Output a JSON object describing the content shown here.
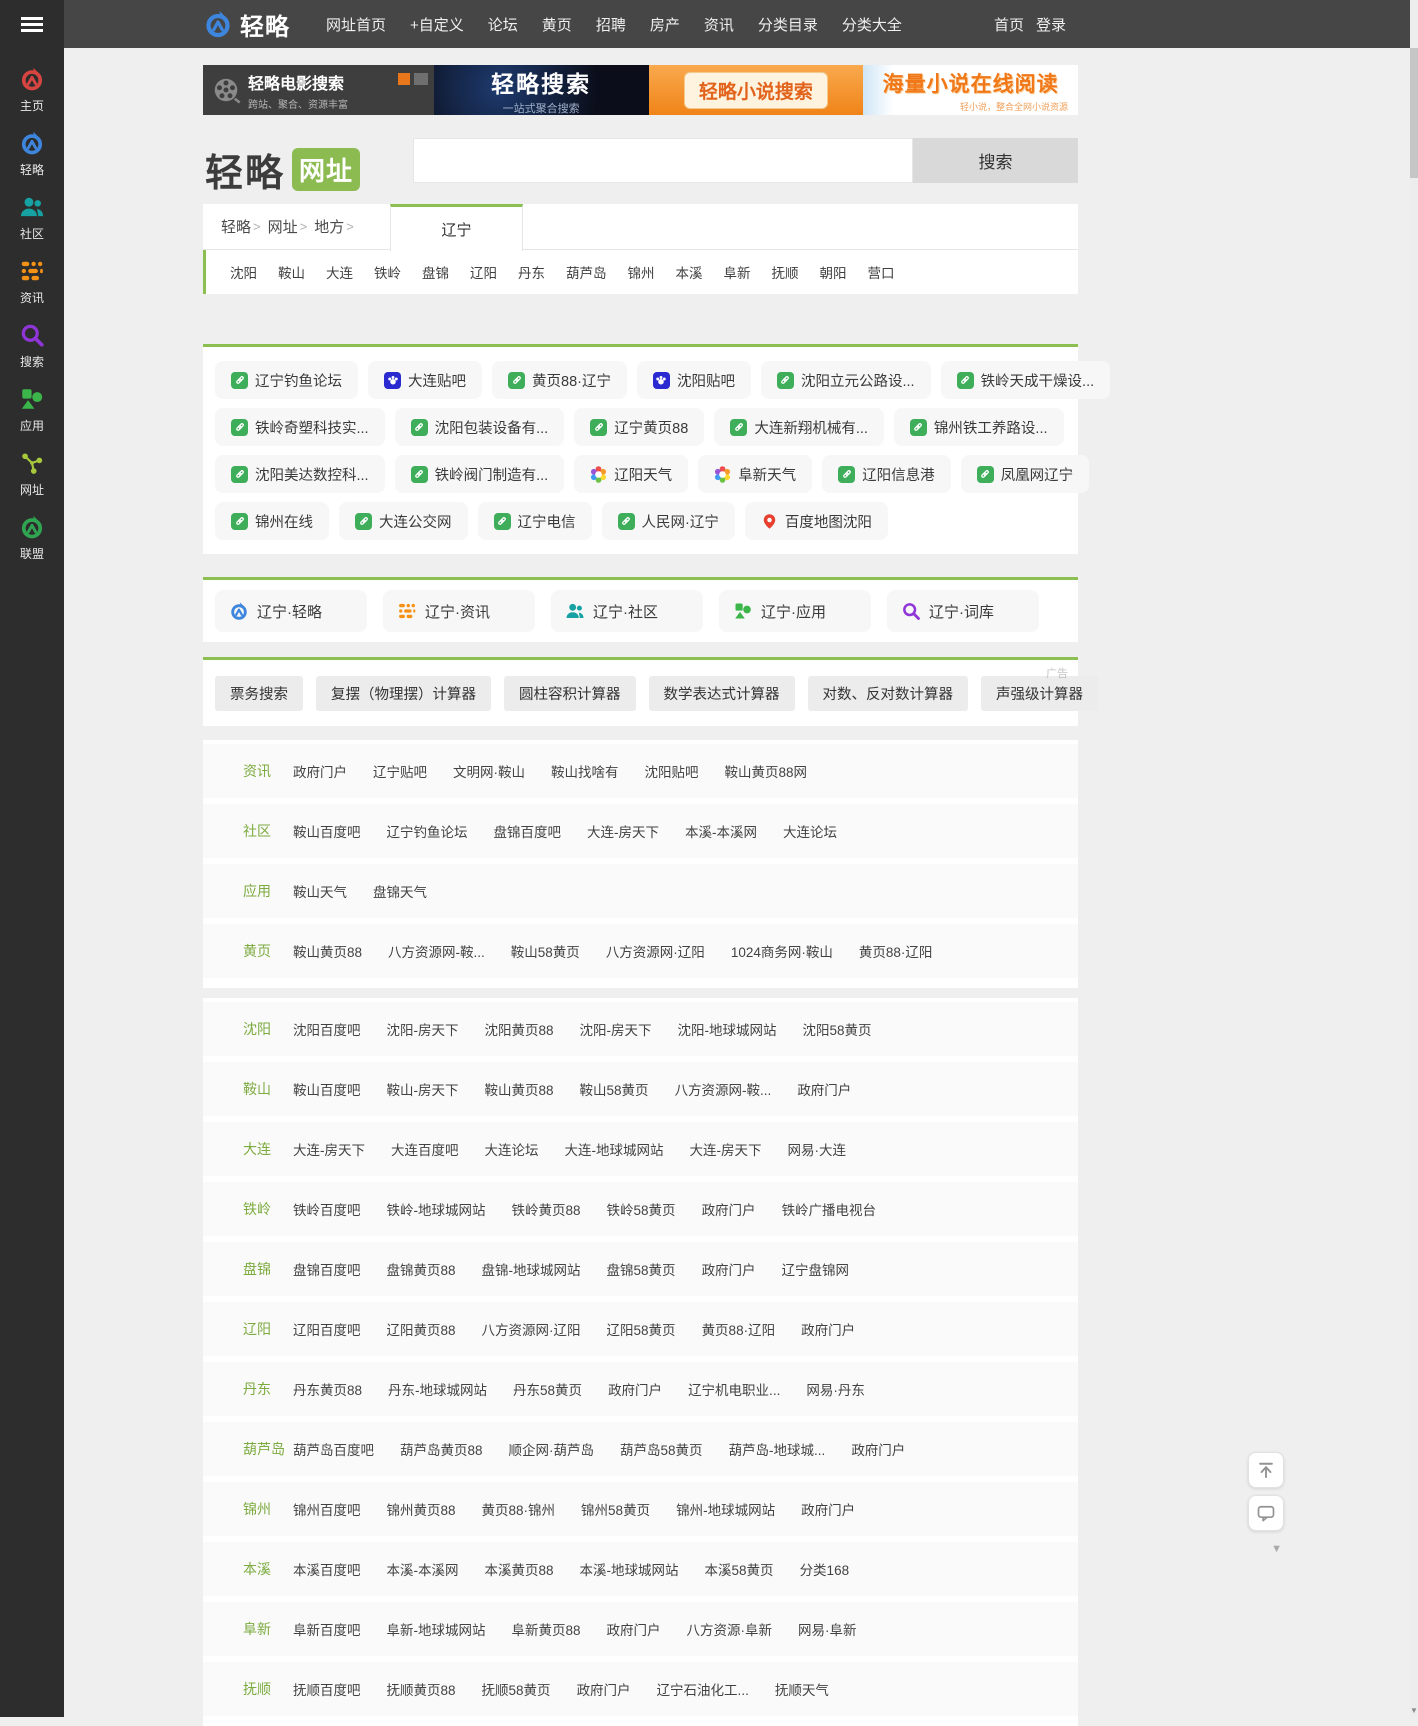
{
  "navbar": {
    "logo": "轻略",
    "menu": [
      "网址首页",
      "+自定义",
      "论坛",
      "黄页",
      "招聘",
      "房产",
      "资讯",
      "分类目录",
      "分类大全"
    ],
    "right_links": [
      "首页",
      "登录"
    ]
  },
  "sidebar": {
    "items": [
      {
        "label": "主页",
        "icon": "logo-red-icon"
      },
      {
        "label": "轻略",
        "icon": "logo-blue-icon"
      },
      {
        "label": "社区",
        "icon": "people-teal-icon"
      },
      {
        "label": "资讯",
        "icon": "grid-orange-icon"
      },
      {
        "label": "搜索",
        "icon": "magnifier-purple-icon"
      },
      {
        "label": "应用",
        "icon": "shapes-green-icon"
      },
      {
        "label": "网址",
        "icon": "share-lime-icon"
      },
      {
        "label": "联盟",
        "icon": "logo-green-icon"
      }
    ]
  },
  "banners": [
    {
      "title": "轻略电影搜索",
      "subtitle": "跨站、聚合、资源丰富"
    },
    {
      "title": "轻略搜索",
      "subtitle": "一站式聚合搜索"
    },
    {
      "title": "轻略小说搜索",
      "subtitle": ""
    },
    {
      "title": "海量小说在线阅读",
      "subtitle": "轻小说，整合全网小说资源"
    }
  ],
  "header": {
    "brand": "轻略",
    "brand_badge": "网址",
    "search_value": "",
    "search_button": "搜索"
  },
  "breadcrumb": {
    "path": [
      "轻略",
      "网址",
      "地方"
    ],
    "active_tab": "辽宁"
  },
  "cities": [
    "沈阳",
    "鞍山",
    "大连",
    "铁岭",
    "盘锦",
    "辽阳",
    "丹东",
    "葫芦岛",
    "锦州",
    "本溪",
    "阜新",
    "抚顺",
    "朝阳",
    "营口"
  ],
  "quick_links": {
    "rows": [
      [
        {
          "label": "辽宁钓鱼论坛",
          "icon": "link-icon",
          "sym": "#sym-chain"
        },
        {
          "label": "大连贴吧",
          "icon": "tieba-icon",
          "sym": "#sym-paw"
        },
        {
          "label": "黄页88·辽宁",
          "icon": "link-icon",
          "sym": "#sym-chain"
        },
        {
          "label": "沈阳贴吧",
          "icon": "tieba-icon",
          "sym": "#sym-paw"
        },
        {
          "label": "沈阳立元公路设...",
          "icon": "link-icon",
          "sym": "#sym-chain"
        },
        {
          "label": "铁岭天成干燥设...",
          "icon": "link-icon",
          "sym": "#sym-chain"
        }
      ],
      [
        {
          "label": "铁岭奇塑科技实...",
          "icon": "link-icon",
          "sym": "#sym-chain"
        },
        {
          "label": "沈阳包装设备有...",
          "icon": "link-icon",
          "sym": "#sym-chain"
        },
        {
          "label": "辽宁黄页88",
          "icon": "link-icon",
          "sym": "#sym-chain"
        },
        {
          "label": "大连新翔机械有...",
          "icon": "link-icon",
          "sym": "#sym-chain"
        },
        {
          "label": "锦州铁工养路设...",
          "icon": "link-icon",
          "sym": "#sym-chain"
        }
      ],
      [
        {
          "label": "沈阳美达数控科...",
          "icon": "link-icon",
          "sym": "#sym-chain"
        },
        {
          "label": "铁岭阀门制造有...",
          "icon": "link-icon",
          "sym": "#sym-chain"
        },
        {
          "label": "辽阳天气",
          "icon": "weather-icon",
          "sym": "#sym-weather"
        },
        {
          "label": "阜新天气",
          "icon": "weather-icon",
          "sym": "#sym-weather"
        },
        {
          "label": "辽阳信息港",
          "icon": "link-icon",
          "sym": "#sym-chain"
        },
        {
          "label": "凤凰网辽宁",
          "icon": "link-icon",
          "sym": "#sym-chain"
        }
      ],
      [
        {
          "label": "锦州在线",
          "icon": "link-icon",
          "sym": "#sym-chain"
        },
        {
          "label": "大连公交网",
          "icon": "link-icon",
          "sym": "#sym-chain"
        },
        {
          "label": "辽宁电信",
          "icon": "link-icon",
          "sym": "#sym-chain"
        },
        {
          "label": "人民网·辽宁",
          "icon": "link-icon",
          "sym": "#sym-chain"
        },
        {
          "label": "百度地图沈阳",
          "icon": "map-pin-icon",
          "sym": "#sym-pin"
        }
      ]
    ]
  },
  "shortcuts": [
    {
      "label": "辽宁·轻略",
      "icon": "logo-blue-icon"
    },
    {
      "label": "辽宁·资讯",
      "icon": "grid-orange-icon"
    },
    {
      "label": "辽宁·社区",
      "icon": "people-teal-icon"
    },
    {
      "label": "辽宁·应用",
      "icon": "shapes-green-icon"
    },
    {
      "label": "辽宁·词库",
      "icon": "magnifier-purple-icon"
    }
  ],
  "tools": {
    "items": [
      "票务搜索",
      "复摆（物理摆）计算器",
      "圆柱容积计算器",
      "数学表达式计算器",
      "对数、反对数计算器",
      "声强级计算器"
    ],
    "ad_label": "广告"
  },
  "category_table": {
    "rows": [
      {
        "label": "资讯",
        "links": [
          "政府门户",
          "辽宁贴吧",
          "文明网·鞍山",
          "鞍山找啥有",
          "沈阳贴吧",
          "鞍山黄页88网"
        ]
      },
      {
        "label": "社区",
        "links": [
          "鞍山百度吧",
          "辽宁钓鱼论坛",
          "盘锦百度吧",
          "大连-房天下",
          "本溪-本溪网",
          "大连论坛"
        ]
      },
      {
        "label": "应用",
        "links": [
          "鞍山天气",
          "盘锦天气"
        ]
      },
      {
        "label": "黄页",
        "links": [
          "鞍山黄页88",
          "八方资源网-鞍...",
          "鞍山58黄页",
          "八方资源网·辽阳",
          "1024商务网·鞍山",
          "黄页88·辽阳"
        ]
      }
    ]
  },
  "city_table": {
    "rows": [
      {
        "label": "沈阳",
        "links": [
          "沈阳百度吧",
          "沈阳-房天下",
          "沈阳黄页88",
          "沈阳-房天下",
          "沈阳-地球城网站",
          "沈阳58黄页"
        ]
      },
      {
        "label": "鞍山",
        "links": [
          "鞍山百度吧",
          "鞍山-房天下",
          "鞍山黄页88",
          "鞍山58黄页",
          "八方资源网-鞍...",
          "政府门户"
        ]
      },
      {
        "label": "大连",
        "links": [
          "大连-房天下",
          "大连百度吧",
          "大连论坛",
          "大连-地球城网站",
          "大连-房天下",
          "网易·大连"
        ]
      },
      {
        "label": "铁岭",
        "links": [
          "铁岭百度吧",
          "铁岭-地球城网站",
          "铁岭黄页88",
          "铁岭58黄页",
          "政府门户",
          "铁岭广播电视台"
        ]
      },
      {
        "label": "盘锦",
        "links": [
          "盘锦百度吧",
          "盘锦黄页88",
          "盘锦-地球城网站",
          "盘锦58黄页",
          "政府门户",
          "辽宁盘锦网"
        ]
      },
      {
        "label": "辽阳",
        "links": [
          "辽阳百度吧",
          "辽阳黄页88",
          "八方资源网·辽阳",
          "辽阳58黄页",
          "黄页88·辽阳",
          "政府门户"
        ]
      },
      {
        "label": "丹东",
        "links": [
          "丹东黄页88",
          "丹东-地球城网站",
          "丹东58黄页",
          "政府门户",
          "辽宁机电职业...",
          "网易·丹东"
        ]
      },
      {
        "label": "葫芦岛",
        "links": [
          "葫芦岛百度吧",
          "葫芦岛黄页88",
          "顺企网·葫芦岛",
          "葫芦岛58黄页",
          "葫芦岛-地球城...",
          "政府门户"
        ]
      },
      {
        "label": "锦州",
        "links": [
          "锦州百度吧",
          "锦州黄页88",
          "黄页88·锦州",
          "锦州58黄页",
          "锦州-地球城网站",
          "政府门户"
        ]
      },
      {
        "label": "本溪",
        "links": [
          "本溪百度吧",
          "本溪-本溪网",
          "本溪黄页88",
          "本溪-地球城网站",
          "本溪58黄页",
          "分类168"
        ]
      },
      {
        "label": "阜新",
        "links": [
          "阜新百度吧",
          "阜新-地球城网站",
          "阜新黄页88",
          "政府门户",
          "八方资源·阜新",
          "网易·阜新"
        ]
      },
      {
        "label": "抚顺",
        "links": [
          "抚顺百度吧",
          "抚顺黄页88",
          "抚顺58黄页",
          "政府门户",
          "辽宁石油化工...",
          "抚顺天气"
        ]
      }
    ]
  },
  "accent_colors": {
    "green": "#8cbf52",
    "label_green": "#7cab3f",
    "navbar_bg": "#464646",
    "sidebar_bg": "#2d2d2d"
  }
}
